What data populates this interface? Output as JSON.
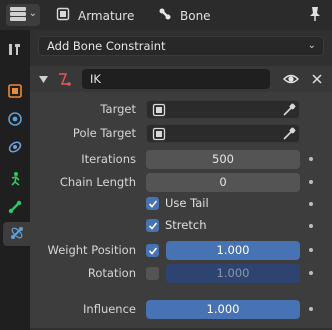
{
  "header": {
    "crumb_object": "Armature",
    "crumb_bone": "Bone"
  },
  "add_constraint": {
    "label": "Add Bone Constraint"
  },
  "constraint": {
    "name": "IK",
    "rows": {
      "target": {
        "label": "Target"
      },
      "pole_target": {
        "label": "Pole Target"
      },
      "iterations": {
        "label": "Iterations",
        "value": "500"
      },
      "chain_length": {
        "label": "Chain Length",
        "value": "0"
      },
      "use_tail": {
        "label": "Use Tail",
        "checked": true
      },
      "stretch": {
        "label": "Stretch",
        "checked": true
      },
      "weight_position": {
        "label": "Weight Position",
        "value": "1.000",
        "checked": true
      },
      "rotation": {
        "label": "Rotation",
        "value": "1.000",
        "checked": false
      },
      "influence": {
        "label": "Influence",
        "value": "1.000"
      }
    }
  },
  "colors": {
    "accent": "#4772b3",
    "panel": "#3d3d3d",
    "background": "#303030",
    "tab_bar": "#1f1f1f"
  },
  "icons": {
    "editor_type": "properties-editor-icon",
    "object": "object-data-icon",
    "bone": "bone-icon",
    "pin": "pin-icon",
    "tabs": [
      "tool-icon",
      "object-icon",
      "physics-icon",
      "object-constraint-icon",
      "pose-icon",
      "bone-icon",
      "bone-constraint-icon"
    ]
  }
}
